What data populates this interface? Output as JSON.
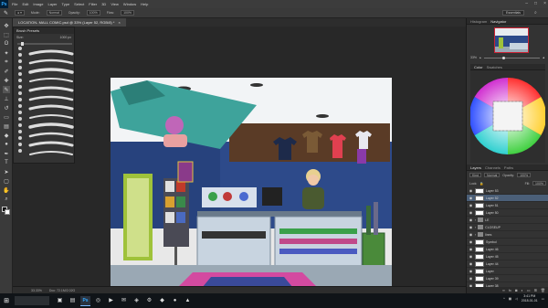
{
  "menubar": {
    "app_icon": "Ps",
    "items": [
      "File",
      "Edit",
      "Image",
      "Layer",
      "Type",
      "Select",
      "Filter",
      "3D",
      "View",
      "Window",
      "Help"
    ],
    "window_controls": [
      "minimize-icon",
      "maximize-icon",
      "close-icon"
    ]
  },
  "options_bar": {
    "mode_label": "Mode:",
    "mode_value": "Normal",
    "opacity_label": "Opacity:",
    "opacity_value": "100%",
    "flow_label": "Flow:",
    "flow_value": "100%",
    "workspace": "Essentials"
  },
  "document": {
    "tab_title": "LOCATION- MALL COMIC.psd @ 33% (Layer 52, RGB/8) *",
    "close_icon": "×",
    "status_zoom": "33.33%",
    "status_doc": "Doc: 72.1M/2.02G"
  },
  "brush_panel": {
    "title": "Brush Presets",
    "size_label": "Size:",
    "size_value": "1000 px"
  },
  "navigator": {
    "tabs": [
      "Histogram",
      "Navigator"
    ],
    "zoom_value": "33%"
  },
  "color_panel": {
    "tabs": [
      "Color",
      "Swatches"
    ]
  },
  "layers_panel": {
    "tabs": [
      "Layers",
      "Channels",
      "Paths"
    ],
    "kind_label": "Kind",
    "blend_mode": "Normal",
    "opacity_label": "Opacity:",
    "opacity_value": "100%",
    "lock_label": "Lock:",
    "fill_label": "Fill:",
    "fill_value": "100%",
    "layers": [
      {
        "name": "Layer 53",
        "type": "layer",
        "visible": true,
        "active": false
      },
      {
        "name": "Layer 52",
        "type": "layer",
        "visible": true,
        "active": true
      },
      {
        "name": "Layer 51",
        "type": "layer",
        "visible": true,
        "active": false
      },
      {
        "name": "Layer 50",
        "type": "layer",
        "visible": true,
        "active": false
      },
      {
        "name": "LE",
        "type": "folder",
        "visible": true,
        "active": false
      },
      {
        "name": "CLOSEUP",
        "type": "folder",
        "visible": true,
        "active": false
      },
      {
        "name": "lines",
        "type": "folder",
        "visible": true,
        "active": false
      },
      {
        "name": "Symbol",
        "type": "layer",
        "visible": true,
        "active": false
      },
      {
        "name": "Layer 46",
        "type": "layer",
        "visible": true,
        "active": false
      },
      {
        "name": "Layer 45",
        "type": "layer",
        "visible": true,
        "active": false
      },
      {
        "name": "Layer 44",
        "type": "layer",
        "visible": true,
        "active": false
      },
      {
        "name": "Layer",
        "type": "layer",
        "visible": true,
        "active": false
      },
      {
        "name": "Layer 39",
        "type": "layer",
        "visible": true,
        "active": false
      },
      {
        "name": "Layer 38",
        "type": "layer",
        "visible": true,
        "active": false
      },
      {
        "name": "Bkg",
        "type": "layer",
        "visible": true,
        "active": false
      }
    ]
  },
  "taskbar": {
    "search_placeholder": "",
    "time": "3:41 PM",
    "date": "2018-01-01"
  },
  "colors": {
    "accent": "#31a8ff",
    "active_layer": "#4b5f78",
    "wall_blue": "#2d4a8a",
    "floor_pink": "#d34aa0",
    "banner_teal": "#3ea39b",
    "shelf_green": "#9fc23a"
  }
}
